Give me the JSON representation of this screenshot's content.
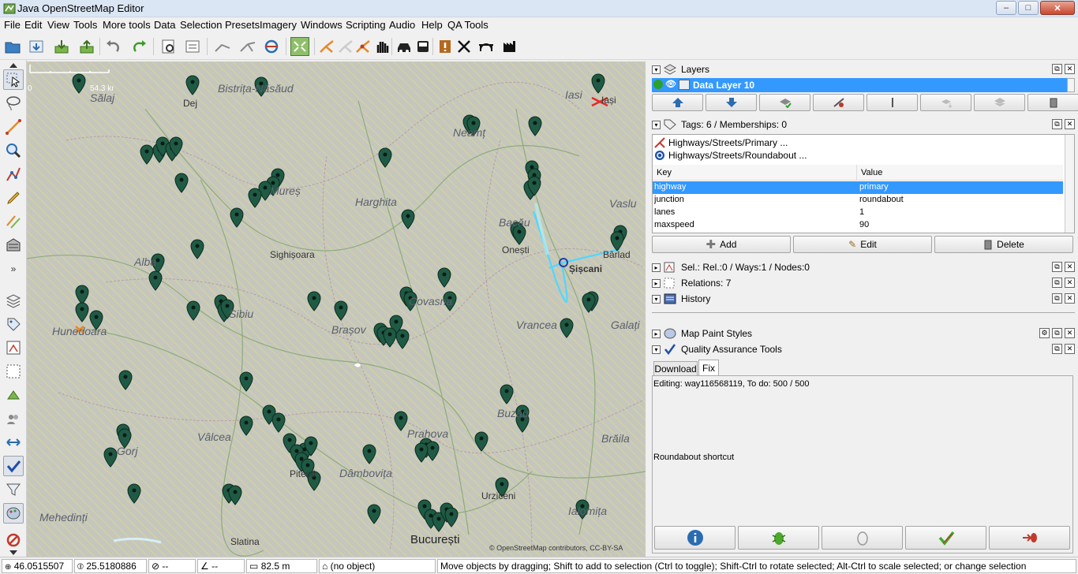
{
  "window": {
    "title": "Java OpenStreetMap Editor",
    "minimize": "–",
    "maximize": "□",
    "close": "✕"
  },
  "menu": [
    "File",
    "Edit",
    "View",
    "Tools",
    "More tools",
    "Data",
    "Selection",
    "Presets",
    "Imagery",
    "Windows",
    "Scripting",
    "Audio",
    "Help",
    "QA Tools"
  ],
  "map": {
    "scale_zero": "0",
    "scale_label": "54.3 km",
    "labels": {
      "bistrita": "Bistrița-Năsăud",
      "dej": "Dej",
      "salaj": "Sălaj",
      "iasi": "Iasi",
      "iasi2": "Iași",
      "neamt": "Neamț",
      "mures": "Mureș",
      "harghita": "Harghita",
      "vaslui": "Vaslu",
      "bacau": "Bacău",
      "onesti": "Onești",
      "siscani": "Șișcani",
      "barlad": "Bârlad",
      "alba": "Alba",
      "sighisoara": "Sighișoara",
      "sibiu": "Sibiu",
      "covasna": "Covasna",
      "brasov": "Brașov",
      "hunedoara": "Hunedoara",
      "vrancea": "Vrancea",
      "galati": "Galați",
      "buzau": "Buzău",
      "valcea": "Vâlcea",
      "prahova": "Prahova",
      "braila": "Brăila",
      "gorj": "Gorj",
      "pitesti": "Pitești",
      "dambovita": "Dâmbovița",
      "urziceni": "Urziceni",
      "mehedinti": "Mehedinți",
      "slatina": "Slatina",
      "bucuresti": "București",
      "ialomita": "Ialomița"
    },
    "attribution": "© OpenStreetMap contributors, CC-BY-SA"
  },
  "layers_panel": {
    "title": "Layers",
    "layer_name": "Data Layer 10"
  },
  "tags_panel": {
    "title": "Tags: 6 / Memberships: 0",
    "presets": [
      "Highways/Streets/Primary ...",
      "Highways/Streets/Roundabout ..."
    ],
    "col_key": "Key",
    "col_value": "Value",
    "rows": [
      {
        "key": "highway",
        "value": "primary"
      },
      {
        "key": "junction",
        "value": "roundabout"
      },
      {
        "key": "lanes",
        "value": "1"
      },
      {
        "key": "maxspeed",
        "value": "90"
      }
    ],
    "add_label": "Add",
    "edit_label": "Edit",
    "delete_label": "Delete"
  },
  "selection_panel": {
    "title": "Sel.: Rel.:0 / Ways:1 / Nodes:0"
  },
  "relations_panel": {
    "title": "Relations: 7"
  },
  "history_panel": {
    "title": "History"
  },
  "mappaint_panel": {
    "title": "Map Paint Styles"
  },
  "qa_panel": {
    "title": "Quality Assurance Tools",
    "tab_download": "Download",
    "tab_fix": "Fix",
    "editing_text": "Editing: way116568119, To do: 500 / 500",
    "shortcut_text": "Roundabout shortcut"
  },
  "status": {
    "lat": "46.0515507",
    "lon": "25.5180886",
    "heading": "--",
    "angle": "--",
    "distance": "82.5 m",
    "object": "(no object)",
    "help": "Move objects by dragging; Shift to add to selection (Ctrl to toggle); Shift-Ctrl to rotate selected; Alt-Ctrl to scale selected; or change selection"
  },
  "colors": {
    "accent_select": "#3399ff",
    "marker": "#1f5a44",
    "map_bg": "#c9cac3",
    "selected_way": "#4fd7ff"
  }
}
